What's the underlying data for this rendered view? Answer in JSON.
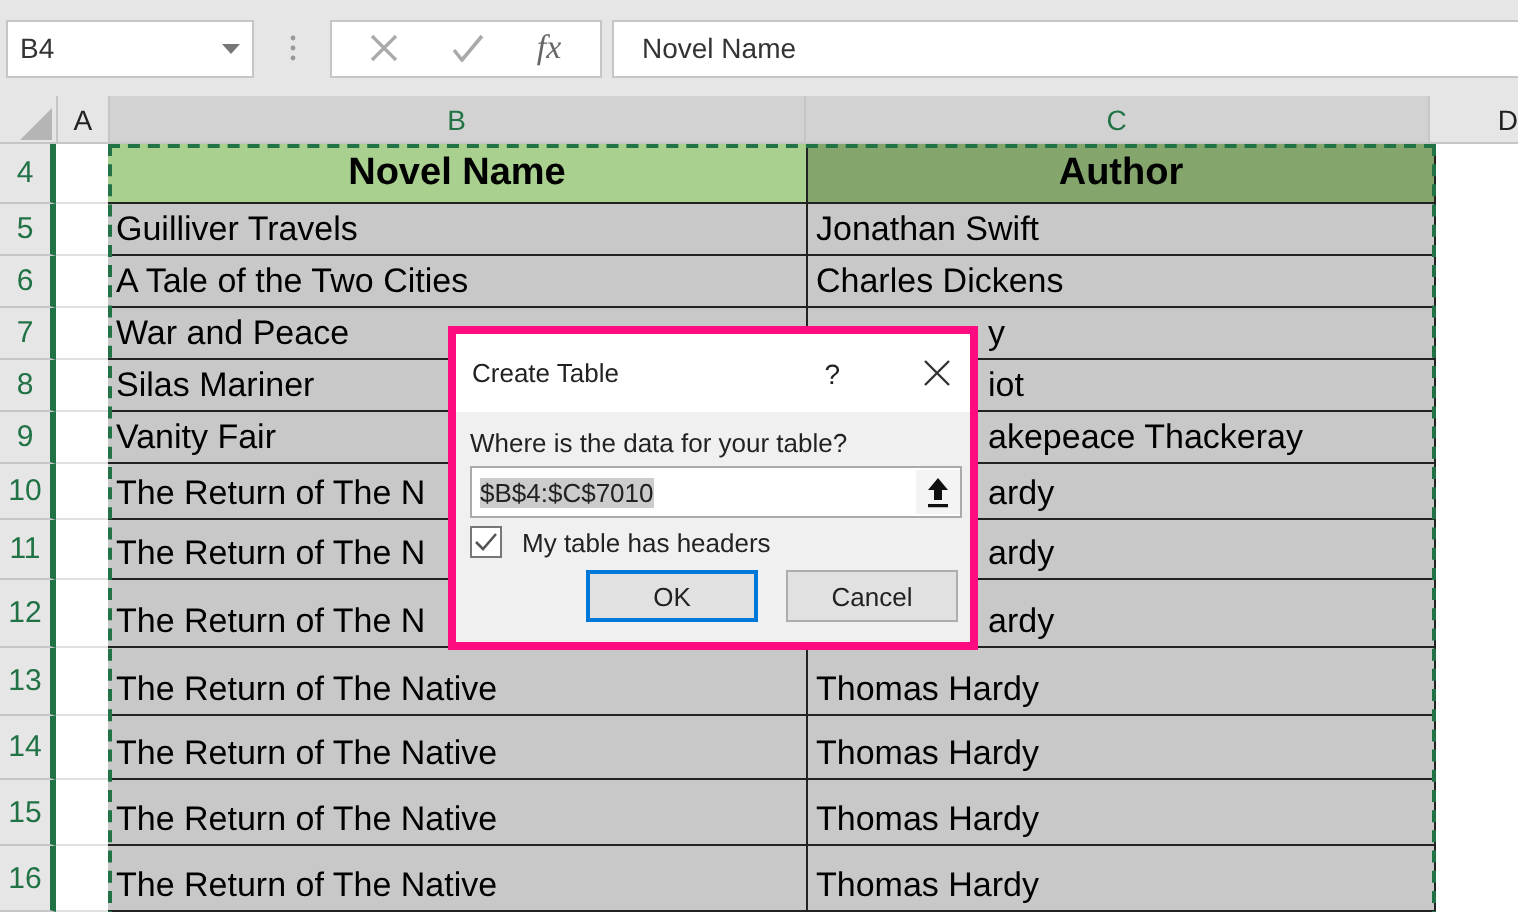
{
  "formula_bar": {
    "name_box": "B4",
    "function_button": "fx",
    "formula": "Novel Name"
  },
  "columns": [
    {
      "label": "A",
      "selected": false
    },
    {
      "label": "B",
      "selected": true
    },
    {
      "label": "C",
      "selected": true
    },
    {
      "label": "D",
      "selected": false
    }
  ],
  "header_row": {
    "number": "4",
    "cells": [
      "Novel Name",
      "Author"
    ]
  },
  "rows": [
    {
      "number": "5",
      "name": "Guilliver Travels",
      "author": "Jonathan Swift",
      "behind_dialog": false
    },
    {
      "number": "6",
      "name": "A Tale of the Two Cities",
      "author": "Charles Dickens",
      "behind_dialog": false
    },
    {
      "number": "7",
      "name": "War and Peace",
      "author": "y",
      "behind_dialog": true
    },
    {
      "number": "8",
      "name": "Silas Mariner",
      "author": "iot",
      "behind_dialog": true
    },
    {
      "number": "9",
      "name": "Vanity Fair",
      "author": "akepeace Thackeray",
      "behind_dialog": true
    },
    {
      "number": "10",
      "name": "The Return of The N",
      "author": "ardy",
      "behind_dialog": true
    },
    {
      "number": "11",
      "name": "The Return of The N",
      "author": "ardy",
      "behind_dialog": true
    },
    {
      "number": "12",
      "name": "The Return of The N",
      "author": "ardy",
      "behind_dialog": true
    },
    {
      "number": "13",
      "name": "The Return of The Native",
      "author": "Thomas Hardy",
      "behind_dialog": false
    },
    {
      "number": "14",
      "name": "The Return of The Native",
      "author": "Thomas Hardy",
      "behind_dialog": false
    },
    {
      "number": "15",
      "name": "The Return of The Native",
      "author": "Thomas Hardy",
      "behind_dialog": false
    },
    {
      "number": "16",
      "name": "The Return of The Native",
      "author": "Thomas Hardy",
      "behind_dialog": false
    }
  ],
  "dialog": {
    "title": "Create Table",
    "help": "?",
    "prompt": "Where is the data for your table?",
    "range": "$B$4:$C$7010",
    "headers_checkbox": {
      "label": "My table has headers",
      "checked": true
    },
    "buttons": [
      {
        "label": "OK",
        "selected": true
      },
      {
        "label": "Cancel",
        "selected": false
      }
    ]
  }
}
